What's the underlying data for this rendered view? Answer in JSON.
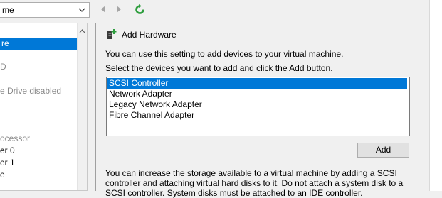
{
  "toolbar": {
    "vm_selector_value": "me",
    "back_icon": "back-arrow-icon",
    "forward_icon": "forward-arrow-icon",
    "refresh_icon": "refresh-icon"
  },
  "tree": {
    "items": [
      {
        "label": "re",
        "selected": true
      },
      {
        "label": "D",
        "disabled": true
      },
      {
        "label": "e Drive disabled",
        "disabled": true
      },
      {
        "label": "ocessor",
        "disabled": true
      },
      {
        "label": "er 0",
        "disabled": false
      },
      {
        "label": "er 1",
        "disabled": false
      },
      {
        "label": "e",
        "disabled": false
      }
    ]
  },
  "panel": {
    "title": "Add Hardware",
    "icon": "add-hardware-icon",
    "description_line1": "You can use this setting to add devices to your virtual machine.",
    "description_line2": "Select the devices you want to add and click the Add button.",
    "devices": [
      "SCSI Controller",
      "Network Adapter",
      "Legacy Network Adapter",
      "Fibre Channel Adapter"
    ],
    "selected_device": "SCSI Controller",
    "add_button": "Add",
    "info_text": "You can increase the storage available to a virtual machine by adding a SCSI controller and attaching virtual hard disks to it. Do not attach a system disk to a SCSI controller. System disks must be attached to an IDE controller."
  },
  "colors": {
    "selection": "#0078d7",
    "background": "#f0f0f0",
    "refresh_green": "#2e9e3e"
  }
}
